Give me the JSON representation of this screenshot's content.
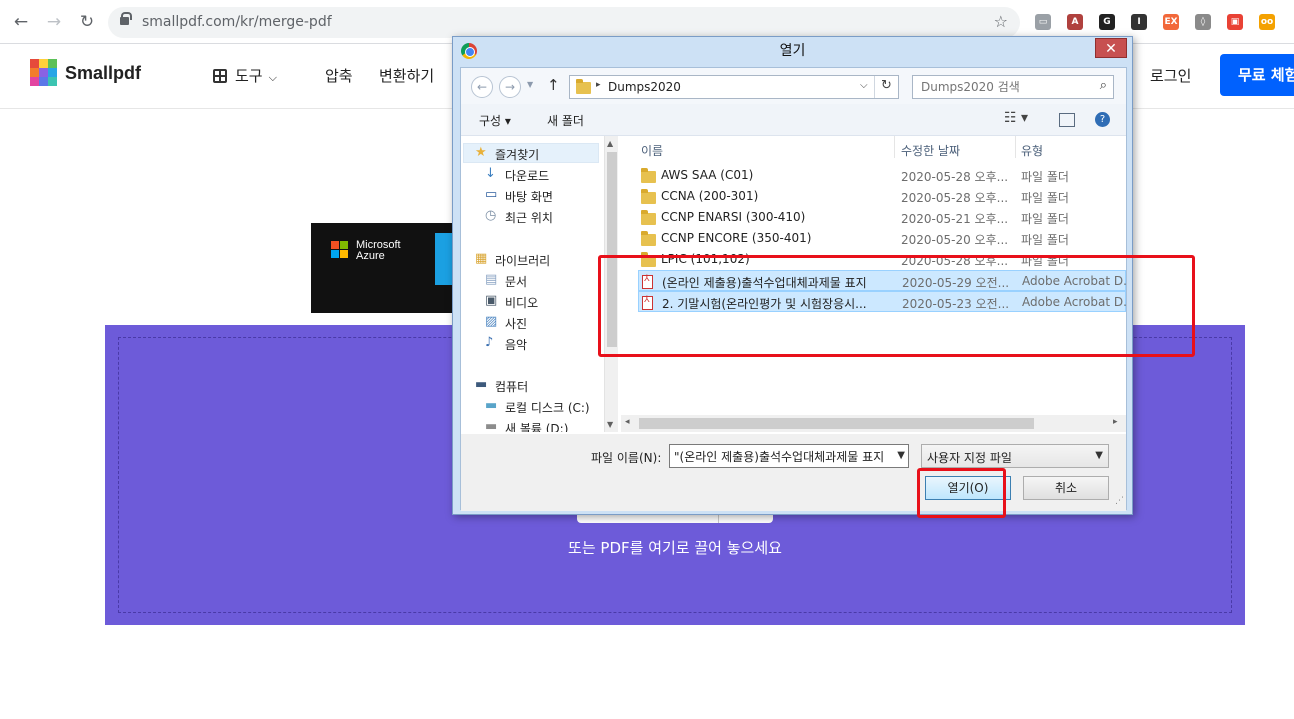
{
  "browser": {
    "url": "smallpdf.com/kr/merge-pdf",
    "back_icon": "←",
    "forward_icon": "→",
    "reload_icon": "↻",
    "star_icon": "☆",
    "extensions": [
      {
        "name": "cast-icon",
        "glyph": "▭",
        "color": "#9aa0a6"
      },
      {
        "name": "adobe-icon",
        "glyph": "A",
        "color": "#b0413e"
      },
      {
        "name": "grammar-icon",
        "glyph": "G",
        "color": "#222222"
      },
      {
        "name": "instapaper-icon",
        "glyph": "I",
        "color": "#333333"
      },
      {
        "name": "ex-icon",
        "glyph": "EX",
        "color": "#f2683a"
      },
      {
        "name": "shield-ext-icon",
        "glyph": "◊",
        "color": "#8a8a8a"
      },
      {
        "name": "screen-ext-icon",
        "glyph": "▣",
        "color": "#e94235"
      },
      {
        "name": "owl-ext-icon",
        "glyph": "oo",
        "color": "#f4a100"
      }
    ]
  },
  "site": {
    "brand": "Smallpdf",
    "nav": [
      "도구",
      "압축",
      "변환하기"
    ],
    "login": "로그인",
    "trial_button": "무료 체험"
  },
  "ad": {
    "line1": "Microsoft",
    "line2": "Azure"
  },
  "dropzone": {
    "hint": "또는 PDF를 여기로 끌어 놓으세요"
  },
  "dialog": {
    "title": "열기",
    "close": "✕",
    "path": "Dumps2020",
    "search_placeholder": "Dumps2020 검색",
    "toolbar": {
      "organize": "구성 ▾",
      "new_folder": "새 폴더"
    },
    "nav_items": [
      {
        "label": "즐겨찾기",
        "icon": "★",
        "color": "#e8b13a"
      },
      {
        "label": "다운로드",
        "icon": "↓",
        "color": "#3c7fc0"
      },
      {
        "label": "바탕 화면",
        "icon": "▭",
        "color": "#2f5f9e"
      },
      {
        "label": "최근 위치",
        "icon": "◷",
        "color": "#7a8da3"
      },
      {
        "label": "라이브러리",
        "icon": "▦",
        "color": "#d9a532"
      },
      {
        "label": "문서",
        "icon": "▤",
        "color": "#8aa3c3"
      },
      {
        "label": "비디오",
        "icon": "▣",
        "color": "#4a5a6a"
      },
      {
        "label": "사진",
        "icon": "▨",
        "color": "#4f87c2"
      },
      {
        "label": "음악",
        "icon": "♪",
        "color": "#3b6fb0"
      },
      {
        "label": "컴퓨터",
        "icon": "▬",
        "color": "#3d5a7c"
      },
      {
        "label": "로컬 디스크 (C:)",
        "icon": "▬",
        "color": "#59a4c9"
      },
      {
        "label": "새 볼륨 (D:)",
        "icon": "▬",
        "color": "#8c8c8c"
      }
    ],
    "columns": {
      "name": "이름",
      "date": "수정한 날짜",
      "type": "유형"
    },
    "files": [
      {
        "name": "AWS SAA (C01)",
        "date": "2020-05-28 오후...",
        "type": "파일 폴더",
        "kind": "folder",
        "selected": false
      },
      {
        "name": "CCNA (200-301)",
        "date": "2020-05-28 오후...",
        "type": "파일 폴더",
        "kind": "folder",
        "selected": false
      },
      {
        "name": "CCNP ENARSI (300-410)",
        "date": "2020-05-21 오후...",
        "type": "파일 폴더",
        "kind": "folder",
        "selected": false
      },
      {
        "name": "CCNP ENCORE (350-401)",
        "date": "2020-05-20 오후...",
        "type": "파일 폴더",
        "kind": "folder",
        "selected": false
      },
      {
        "name": "LPIC (101,102)",
        "date": "2020-05-28 오후...",
        "type": "파일 폴더",
        "kind": "folder",
        "selected": false
      },
      {
        "name": "(온라인 제출용)출석수업대체과제물 표지",
        "date": "2020-05-29 오전...",
        "type": "Adobe Acrobat D...",
        "kind": "pdf",
        "selected": true
      },
      {
        "name": "2. 기말시험(온라인평가 및 시험장응시...",
        "date": "2020-05-23 오전...",
        "type": "Adobe Acrobat D...",
        "kind": "pdf",
        "selected": true
      }
    ],
    "filename_label": "파일 이름(N):",
    "filename_value": "\"(온라인 제출용)출석수업대체과제물 표지",
    "filetype": "사용자 지정 파일",
    "open_button": "열기(O)",
    "cancel_button": "취소"
  },
  "colors": {
    "accent": "#0061fe",
    "dropzone": "#6d5bd9",
    "highlight": "#e8101a",
    "selection": "#cce8ff"
  }
}
